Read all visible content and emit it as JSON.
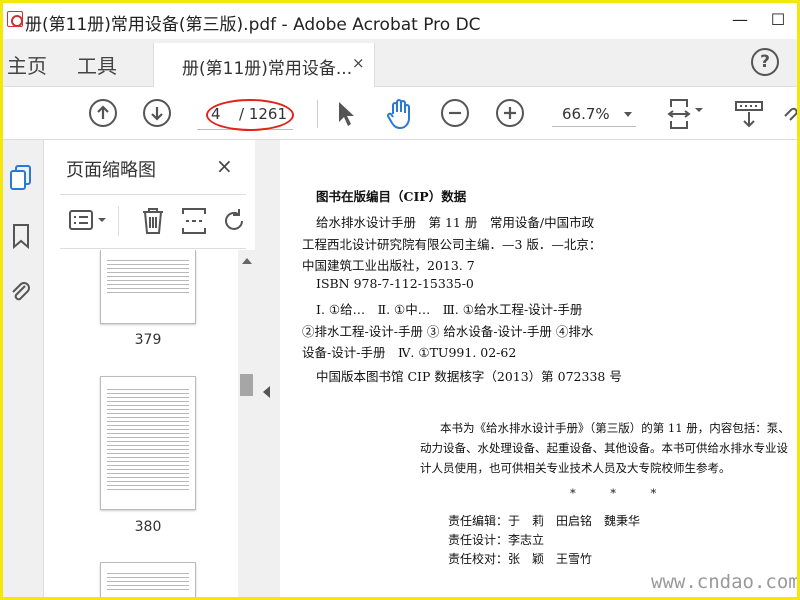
{
  "window": {
    "title": "册(第11册)常用设备(第三版).pdf - Adobe Acrobat Pro DC",
    "minimize": "—",
    "maximize": "☐"
  },
  "tabs": {
    "home": "主页",
    "tools": "工具",
    "document": "册(第11册)常用设备...",
    "close": "×",
    "help": "?"
  },
  "toolbar": {
    "current_page": "4",
    "total_pages": "/ 1261",
    "zoom": "66.7%",
    "icons": [
      "arrow-up-icon",
      "arrow-down-icon",
      "select-arrow-icon",
      "hand-icon",
      "zoom-out-icon",
      "zoom-in-icon",
      "fit-page-icon",
      "scroll-mode-icon",
      "link-icon"
    ]
  },
  "left_rail": {
    "icons": [
      "page-thumbnails-icon",
      "bookmark-icon",
      "attachment-icon"
    ]
  },
  "thumbnails_panel": {
    "title": "页面缩略图",
    "close": "×",
    "tools": [
      "options-menu-icon",
      "delete-page-icon",
      "extract-page-icon",
      "rotate-page-icon"
    ],
    "pages": [
      {
        "label": "379"
      },
      {
        "label": "380"
      }
    ]
  },
  "document": {
    "cip_title": "图书在版编目（CIP）数据",
    "cip_lines": [
      "给水排水设计手册　第 11 册　常用设备/中国市政",
      "工程西北设计研究院有限公司主编．—3 版．—北京：",
      "中国建筑工业出版社，2013. 7",
      "ISBN 978-7-112-15335-0",
      "Ⅰ. ①给…　Ⅱ. ①中…　Ⅲ. ①给水工程-设计-手册",
      "②排水工程-设计-手册 ③ 给水设备-设计-手册 ④排水",
      "设备-设计-手册　Ⅳ. ①TU991. 02-62",
      "中国版本图书馆 CIP 数据核字（2013）第 072338 号"
    ],
    "abstract_lines": [
      "本书为《给水排水设计手册》（第三版）的第 11 册，内容包括：泵、",
      "动力设备、水处理设备、起重设备、其他设备。本书可供给水排水专业设",
      "计人员使用，也可供相关专业技术人员及大专院校师生参考。"
    ],
    "stars": "*　　　*　　　*",
    "credits": [
      "责任编辑：于　莉　田启铭　魏秉华",
      "责任设计：李志立",
      "责任校对：张　颖　王雪竹"
    ]
  },
  "watermark": "www.cndao.com",
  "colors": {
    "frame": "#f5e60c",
    "annotation": "#e0241c",
    "accent": "#2a7ad4"
  }
}
